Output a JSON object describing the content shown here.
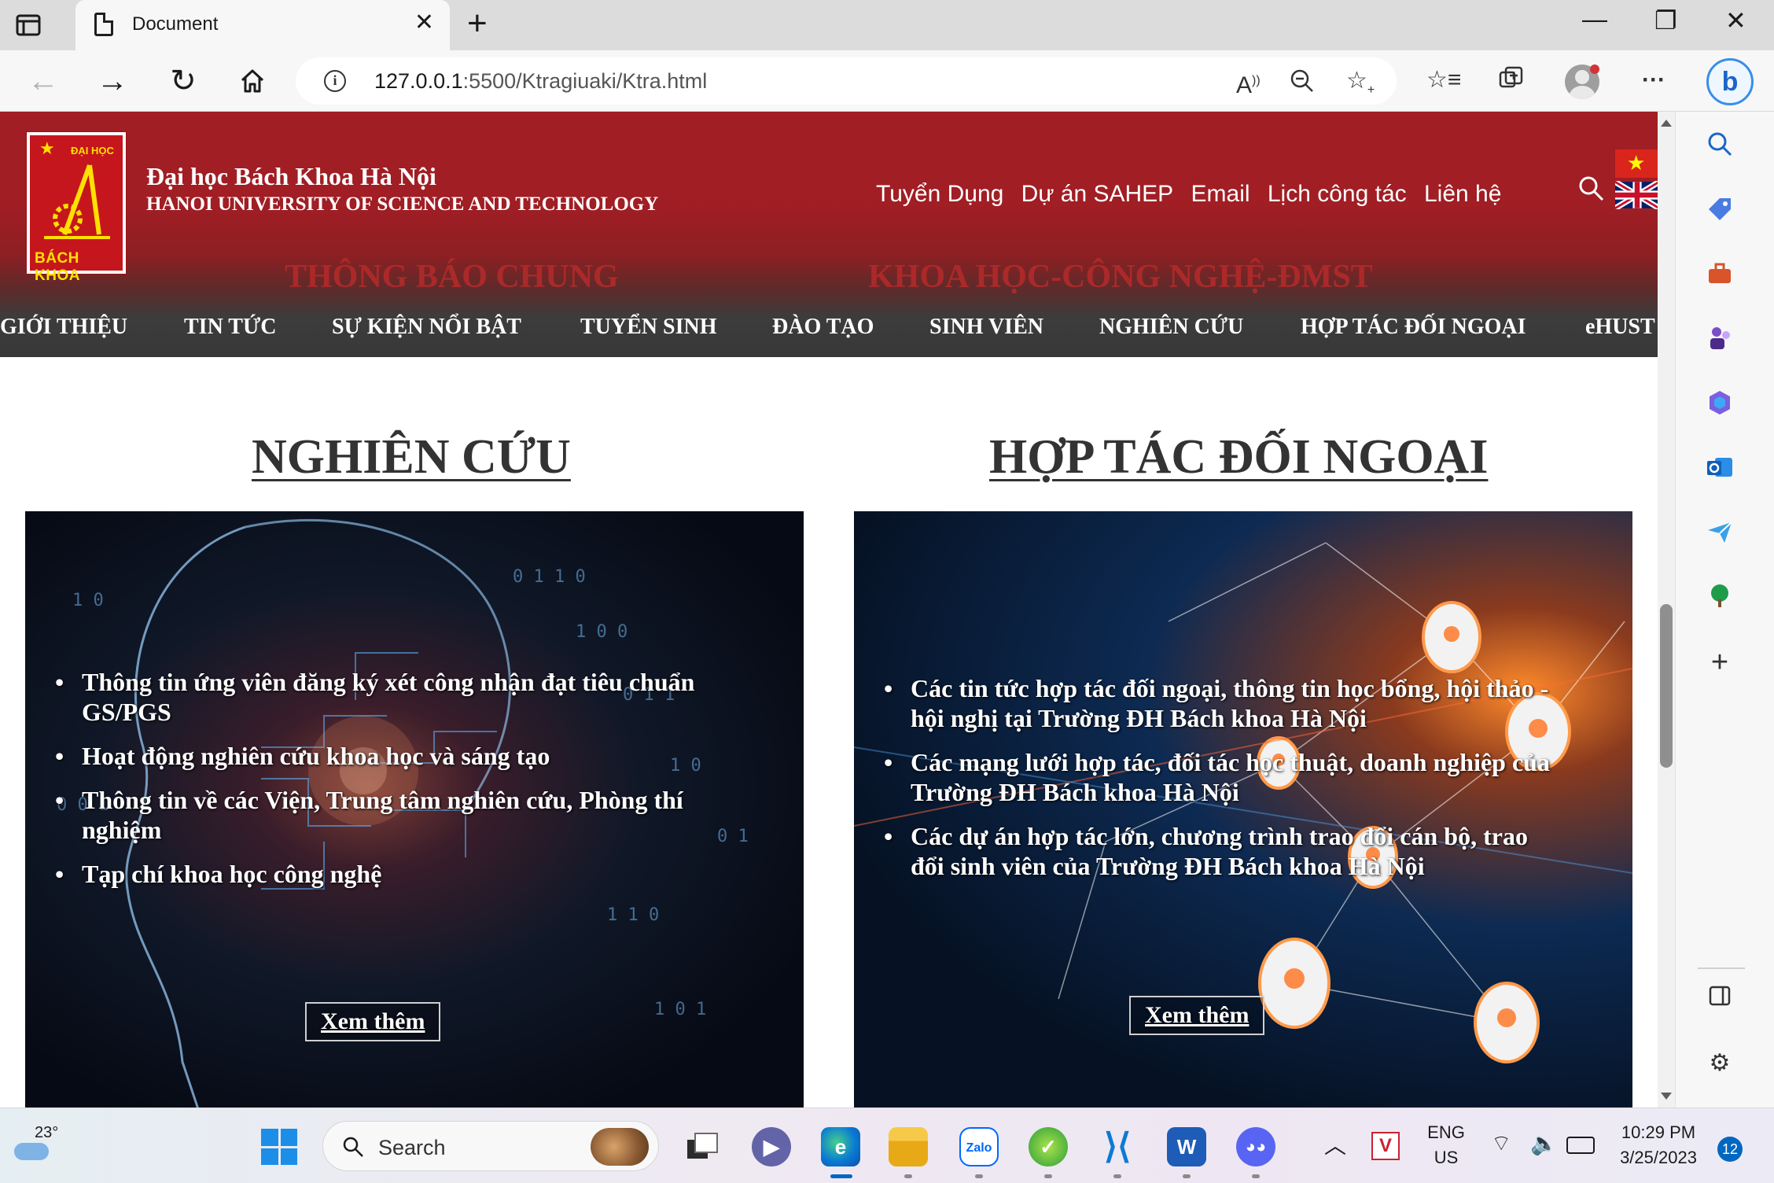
{
  "browser": {
    "tab_title": "Document",
    "url_host": "127.0.0.1",
    "url_rest": ":5500/Ktragiuaki/Ktra.html"
  },
  "site": {
    "logo": {
      "top_text": "ĐẠI HỌC",
      "bottom_text": "BÁCH KHOA"
    },
    "name_vi": "Đại học Bách Khoa Hà Nội",
    "name_en": "HANOI UNIVERSITY OF SCIENCE AND TECHNOLOGY",
    "top_links": [
      "Tuyển Dụng",
      "Dự án SAHEP",
      "Email",
      "Lịch công tác",
      "Liên hệ"
    ],
    "faded_links": [
      "THÔNG BÁO CHUNG",
      "KHOA HỌC-CÔNG NGHỆ-ĐMST"
    ],
    "nav": [
      "GIỚI THIỆU",
      "TIN TỨC",
      "SỰ KIỆN NỔI BẬT",
      "TUYỂN SINH",
      "ĐÀO TẠO",
      "SINH VIÊN",
      "NGHIÊN CỨU",
      "HỢP TÁC ĐỐI NGOẠI",
      "eHUST"
    ]
  },
  "sections": [
    {
      "title": "NGHIÊN CỨU",
      "items": [
        "Thông tin ứng viên đăng ký xét công nhận đạt tiêu chuẩn GS/PGS",
        "Hoạt động nghiên cứu khoa học và sáng tạo",
        "Thông tin về các Viện, Trung tâm nghiên cứu, Phòng thí nghiệm",
        "Tạp chí khoa học công nghệ"
      ],
      "more": "Xem thêm"
    },
    {
      "title": "HỢP TÁC ĐỐI NGOẠI",
      "items": [
        "Các tin tức hợp tác đối ngoại, thông tin học bổng, hội thảo - hội nghị tại Trường ĐH Bách khoa Hà Nội",
        "Các mạng lưới hợp tác, đối tác học thuật, doanh nghiệp của Trường ĐH Bách khoa Hà Nội",
        "Các dự án hợp tác lớn, chương trình trao đổi cán bộ, trao đổi sinh viên của Trường ĐH Bách khoa Hà Nội"
      ],
      "more": "Xem thêm"
    }
  ],
  "taskbar": {
    "weather_temp": "23°",
    "search_label": "Search",
    "lang_1": "ENG",
    "lang_2": "US",
    "time": "10:29 PM",
    "date": "3/25/2023",
    "notifications": "12"
  },
  "colors": {
    "header_red": "#a01e24",
    "nav_dark": "#383838",
    "edge_blue": "#0067c0"
  }
}
